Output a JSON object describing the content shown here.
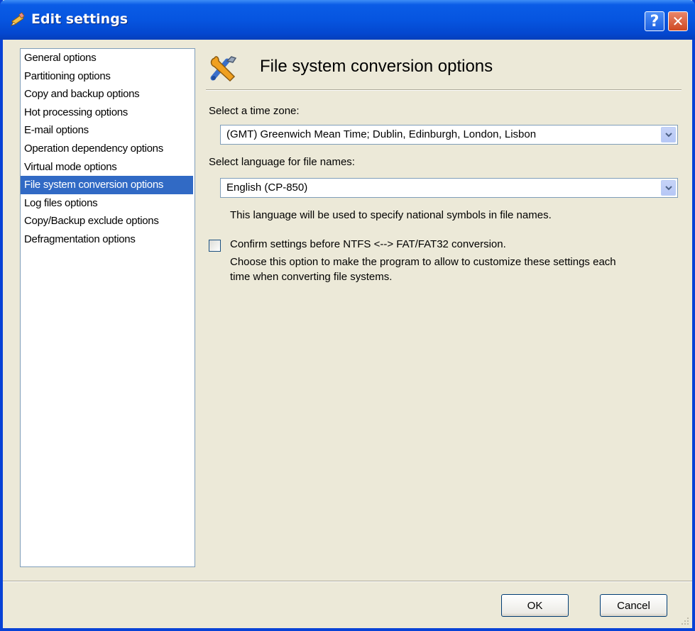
{
  "window": {
    "title": "Edit settings",
    "help_label": "?",
    "close_label": "✕",
    "title_icon": "pencil-icon"
  },
  "nav": {
    "items": [
      {
        "label": "General options"
      },
      {
        "label": "Partitioning options"
      },
      {
        "label": "Copy and backup options"
      },
      {
        "label": "Hot processing options"
      },
      {
        "label": "E-mail options"
      },
      {
        "label": "Operation dependency options"
      },
      {
        "label": "Virtual mode options"
      },
      {
        "label": "File system conversion options",
        "selected": true
      },
      {
        "label": "Log files options"
      },
      {
        "label": "Copy/Backup exclude options"
      },
      {
        "label": "Defragmentation options"
      }
    ],
    "selected_color": "#316ac5"
  },
  "content": {
    "header_icon": "tools-icon",
    "title": "File system conversion options",
    "timezone_label": "Select a time zone:",
    "timezone_value": "(GMT) Greenwich Mean Time; Dublin, Edinburgh, London, Lisbon",
    "language_label": "Select language for file names:",
    "language_value": "English (CP-850)",
    "language_hint": "This language will be used to specify national symbols in file names.",
    "confirm_label": "Confirm settings before NTFS <--> FAT/FAT32 conversion.",
    "confirm_checked": false,
    "confirm_hint_line1": "Choose this option to make the program to allow to customize these settings each",
    "confirm_hint_line2": "time when converting file systems."
  },
  "buttons": {
    "ok": "OK",
    "cancel": "Cancel"
  },
  "colors": {
    "titlebar": "#0655e0",
    "dialog_bg": "#ece9d8",
    "border": "#7f9db9"
  }
}
